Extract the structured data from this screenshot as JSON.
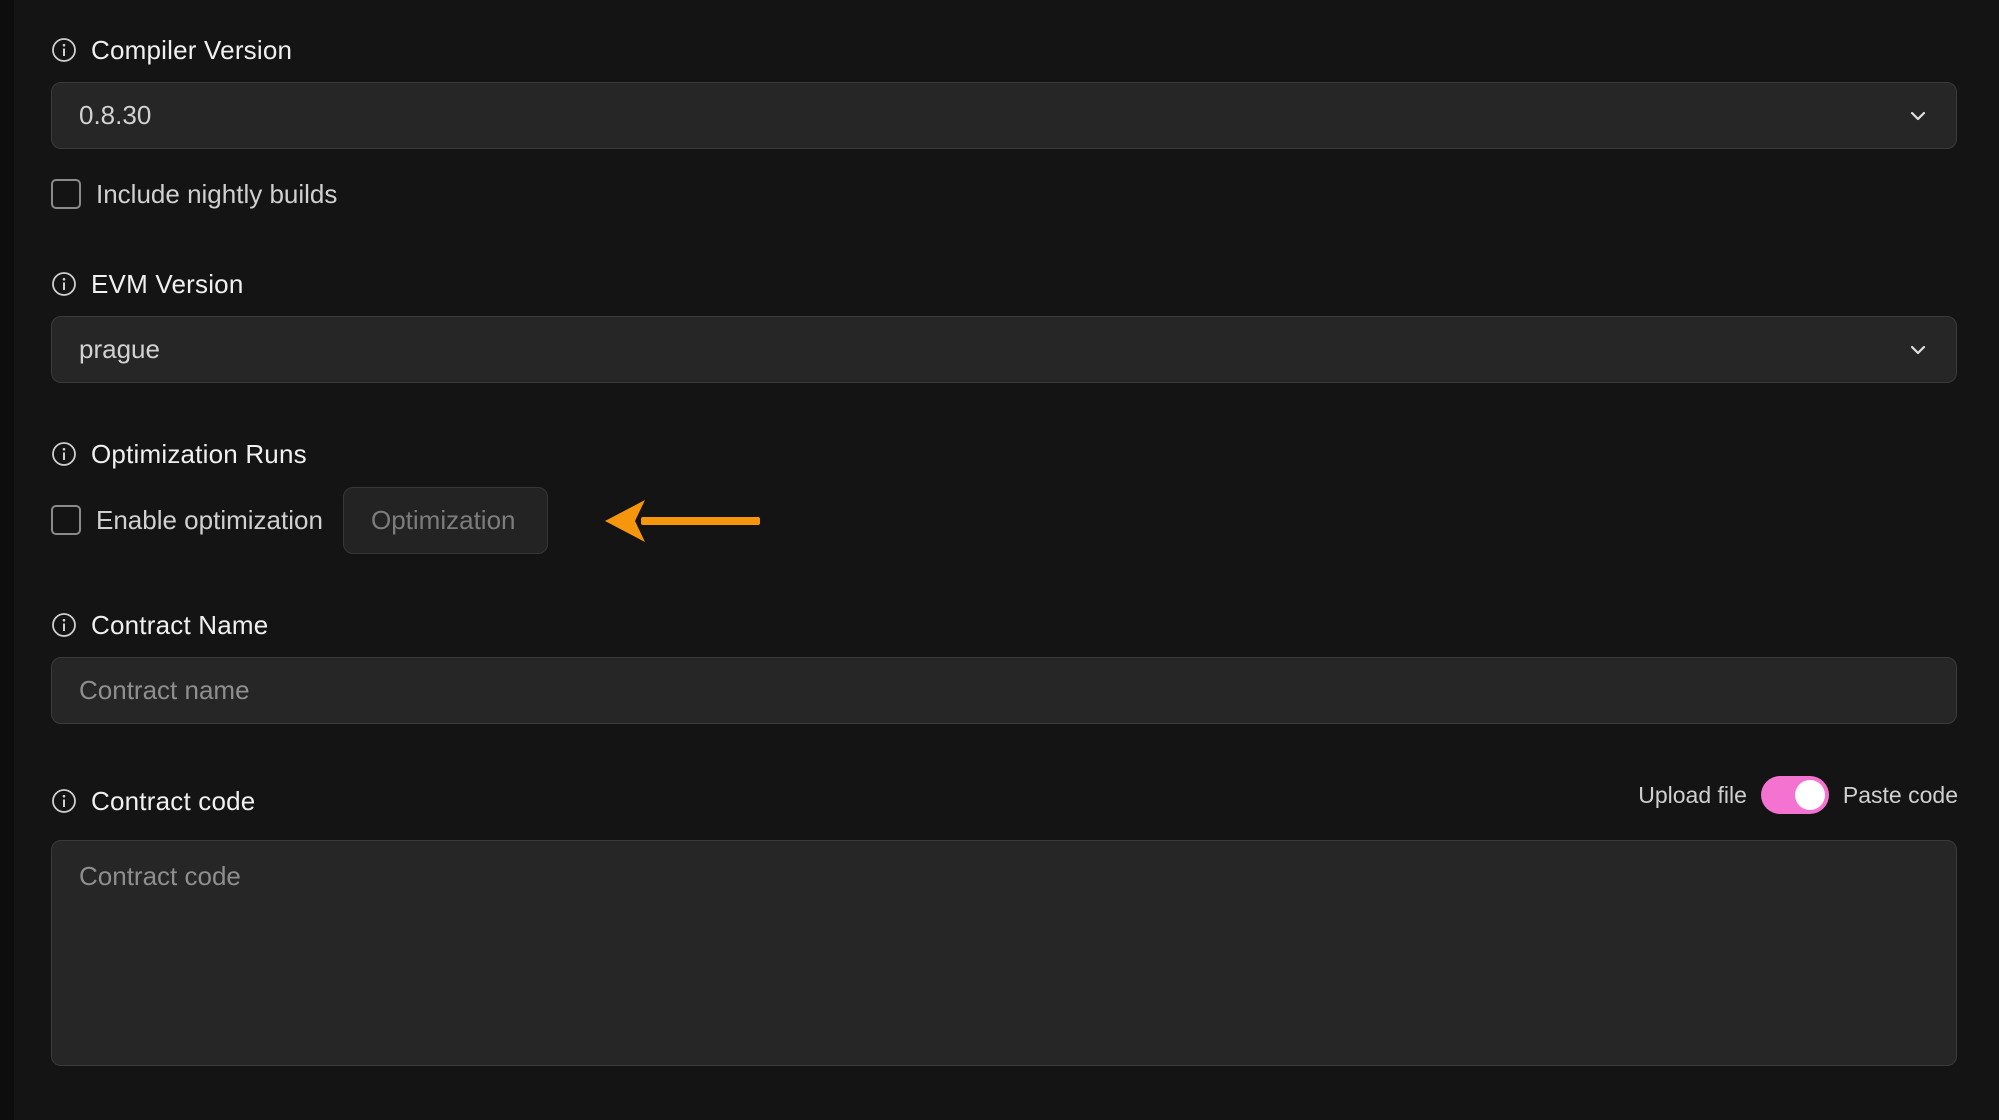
{
  "compiler": {
    "label": "Compiler Version",
    "value": "0.8.30",
    "nightly_label": "Include nightly builds",
    "nightly_checked": false
  },
  "evm": {
    "label": "EVM Version",
    "value": "prague"
  },
  "optimization": {
    "label": "Optimization Runs",
    "enable_label": "Enable optimization",
    "enable_checked": false,
    "runs_placeholder": "Optimization"
  },
  "contract_name": {
    "label": "Contract Name",
    "placeholder": "Contract name"
  },
  "contract_code": {
    "label": "Contract code",
    "placeholder": "Contract code",
    "upload_label": "Upload file",
    "paste_label": "Paste code",
    "toggle_on": true
  },
  "colors": {
    "toggle_accent": "#f472d0",
    "annotation_arrow": "#f5960c",
    "background": "#141414",
    "field_background": "#262626"
  },
  "icons": {
    "info": "info-circle-icon",
    "chevron": "chevron-down-icon",
    "annotation": "arrow-left-icon"
  }
}
